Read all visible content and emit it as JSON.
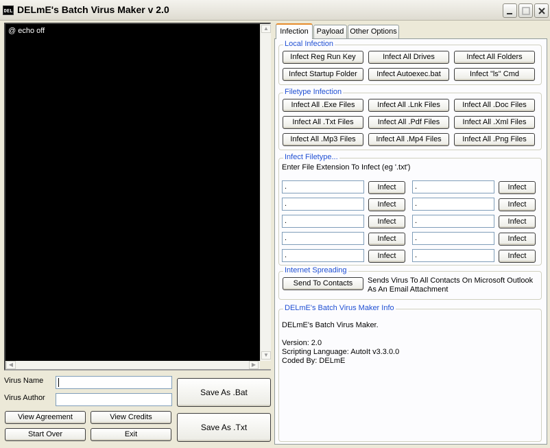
{
  "window": {
    "title": "DELmE's Batch Virus Maker v 2.0",
    "app_icon_text": "DEL"
  },
  "console": {
    "text": "@ echo off"
  },
  "left_form": {
    "virus_name_label": "Virus Name",
    "virus_name_value": "",
    "virus_author_label": "Virus Author",
    "virus_author_value": "",
    "save_bat": "Save As .Bat",
    "save_txt": "Save As .Txt",
    "view_agreement": "View Agreement",
    "view_credits": "View Credits",
    "start_over": "Start Over",
    "exit": "Exit"
  },
  "tabs": [
    "Infection",
    "Payload",
    "Other Options"
  ],
  "local_infection": {
    "title": "Local Infection",
    "buttons": [
      "Infect Reg Run Key",
      "Infect All Drives",
      "Infect All Folders",
      "Infect Startup Folder",
      "Infect Autoexec.bat",
      "Infect \"ls\" Cmd"
    ]
  },
  "filetype_infection": {
    "title": "Filetype Infection",
    "buttons": [
      "Infect All .Exe Files",
      "Infect All .Lnk Files",
      "Infect All .Doc Files",
      "Infect All .Txt Files",
      "Infect All .Pdf Files",
      "Infect All .Xml Files",
      "Infect All .Mp3 Files",
      "Infect All .Mp4 Files",
      "Infect All .Png Files"
    ]
  },
  "infect_filetype": {
    "title": "Infect Filetype...",
    "instruction": "Enter File Extension To Infect (eg '.txt')",
    "field_value": ".",
    "button_label": "Infect"
  },
  "internet_spreading": {
    "title": "Internet Spreading",
    "button": "Send To Contacts",
    "description_line1": "Sends Virus To All Contacts On Microsoft Outlook",
    "description_line2": "As An Email Attachment"
  },
  "info": {
    "title": "DELmE's Batch Virus Maker Info",
    "line1": "DELmE's Batch Virus Maker.",
    "version": "Version: 2.0",
    "language": "Scripting Language: AutoIt v3.3.0.0",
    "coded_by": "Coded By: DELmE"
  },
  "colors": {
    "group_title": "#1f4fd3",
    "tab_highlight": "#e68b2c",
    "console_bg": "#000000"
  }
}
